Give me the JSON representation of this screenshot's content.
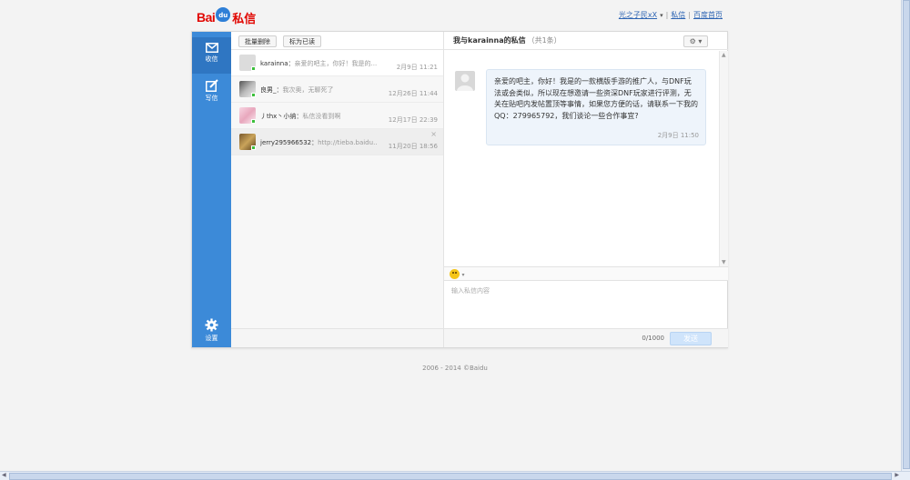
{
  "header": {
    "logo_bai": "Bai",
    "logo_paw": "du",
    "logo_product": "私信",
    "username": "光之子民xX",
    "caret": "▾",
    "link_messages": "私信",
    "link_home": "百度首页",
    "separator": "|"
  },
  "sidebar": {
    "inbox_label": "收信",
    "compose_label": "写信",
    "settings_label": "设置"
  },
  "list_toolbar": {
    "batch_delete": "批量删除",
    "mark_read": "标为已读"
  },
  "conversations": [
    {
      "name": "karainna",
      "sep": "：",
      "preview": "亲爱的吧主，你好！我是的...",
      "time": "2月9日 11:21"
    },
    {
      "name": "良男_",
      "sep": "：",
      "preview": "我次奥，无聊死了",
      "time": "12月26日 11:44"
    },
    {
      "name": "丿thx丶小纳",
      "sep": "：",
      "preview": "私信没看到啊",
      "time": "12月17日 22:39"
    },
    {
      "name": "jerry295966532",
      "sep": "：",
      "preview": "http://tieba.baidu....",
      "time": "11月20日 18:56",
      "close": "×"
    }
  ],
  "chat": {
    "title_prefix": "我与",
    "title_user": "karainna",
    "title_suffix": "的私信",
    "count": "（共1条）",
    "gear": "⚙ ▾",
    "message_text": "亲爱的吧主，你好！我是的一款横版手游的推广人，与DNF玩法或会类似，所以现在想邀请一些资深DNF玩家进行评测，无关在贴吧内发帖置顶等事情，如果您方便的话，请联系一下我的QQ：279965792，我们谈论一些合作事宜?",
    "message_time": "2月9日 11:50",
    "emoji_caret": "▾",
    "input_placeholder": "输入私信内容",
    "char_count": "0/1000",
    "send_label": "发送"
  },
  "footer": {
    "copyright": "2006 - 2014 ©Baidu"
  },
  "colors": {
    "sidebar": "#3c8ad8",
    "brand_red": "#e10601",
    "link": "#2d64b3",
    "bubble": "#eef4fb"
  }
}
